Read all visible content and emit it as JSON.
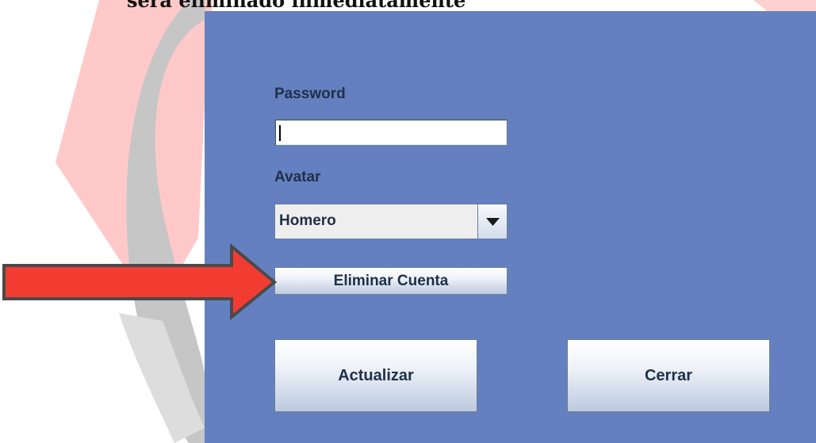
{
  "caption": {
    "text": "será eliminado inmediatamente"
  },
  "form": {
    "password_label": "Password",
    "password_value": "",
    "avatar_label": "Avatar",
    "avatar_selected": "Homero",
    "delete_button": "Eliminar Cuenta",
    "update_button": "Actualizar",
    "close_button": "Cerrar"
  },
  "colors": {
    "panel": "#6480c0",
    "label_text": "#20304a",
    "arrow": "#f23c32",
    "button_top": "#ffffff",
    "button_bottom": "#bccadf"
  },
  "icons": {
    "dropdown": "triangle-down-icon",
    "pointer": "red-arrow-right-icon"
  }
}
